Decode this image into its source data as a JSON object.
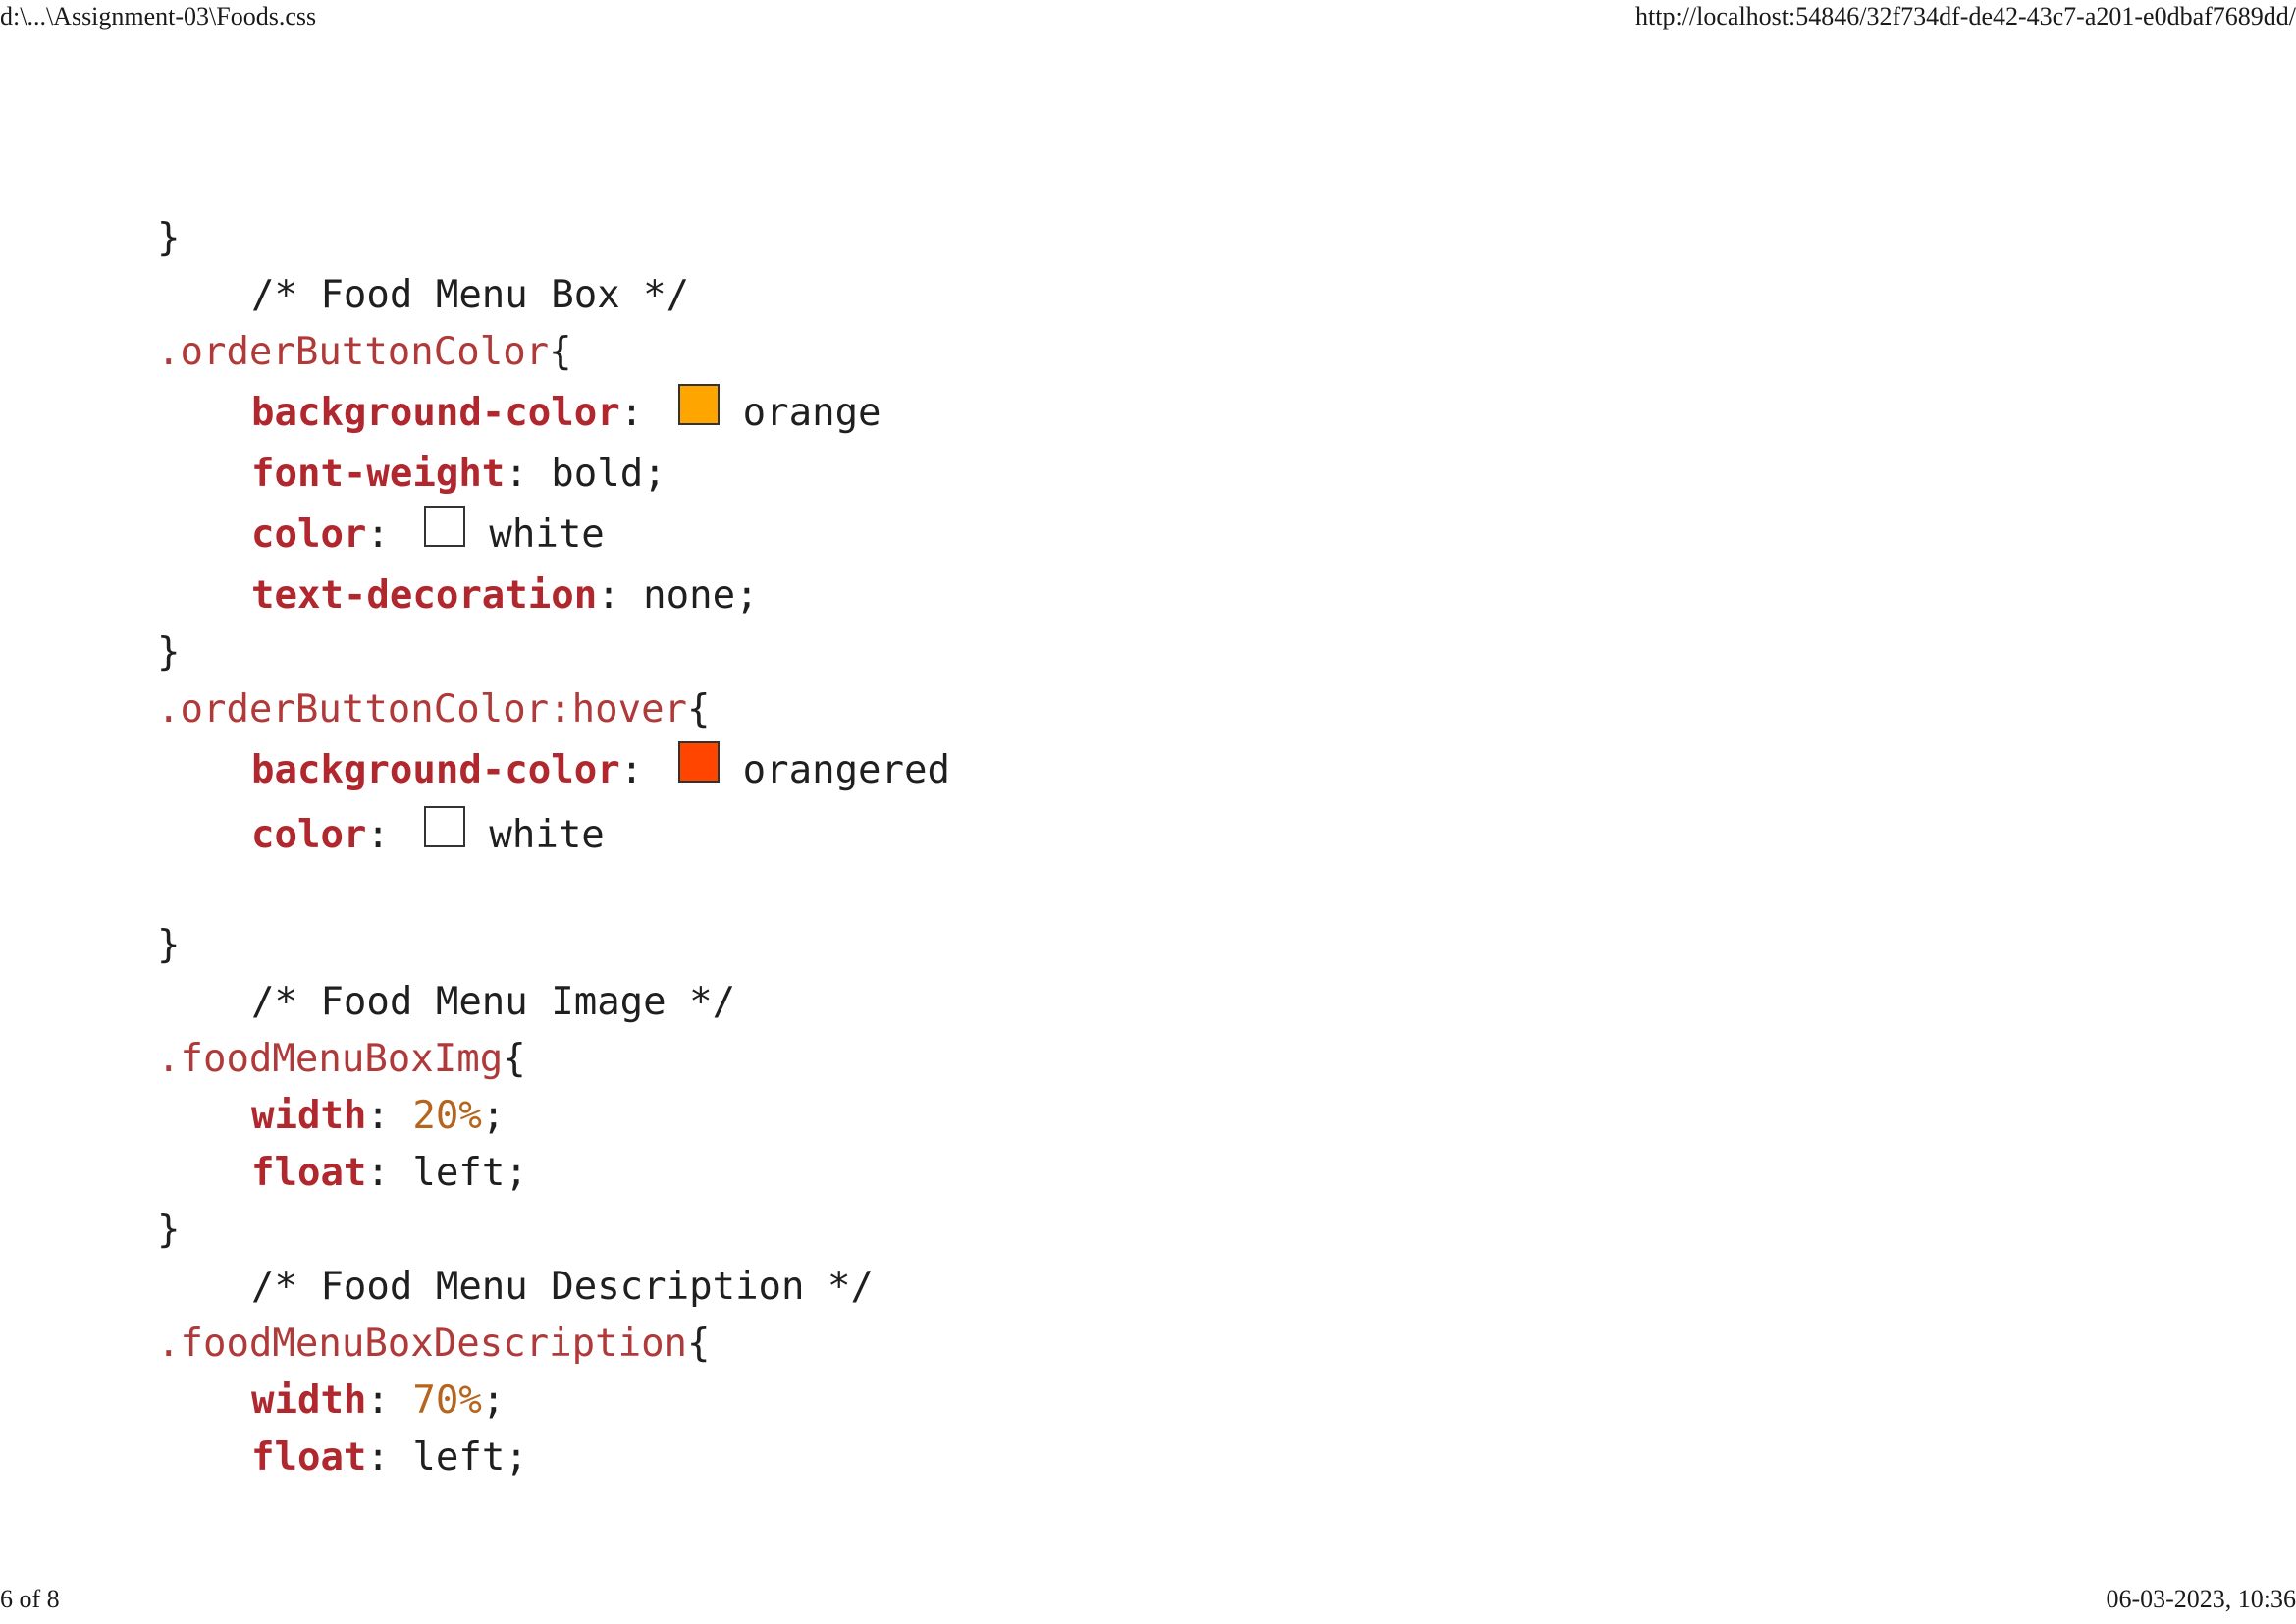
{
  "print_header": {
    "file_path": "d:\\...\\Assignment-03\\Foods.css",
    "url": "http://localhost:54846/32f734df-de42-43c7-a201-e0dbaf7689dd/"
  },
  "print_footer": {
    "page": "6 of 8",
    "datetime": "06-03-2023, 10:36"
  },
  "code": {
    "brace_close": "}",
    "brace_open": "{",
    "colon": ": ",
    "semicolon": ";",
    "comment_menu_box": "/* Food Menu Box */",
    "sel_order_button": ".orderButtonColor",
    "sel_order_button_hover": ".orderButtonColor:hover",
    "comment_menu_image": "/* Food Menu Image */",
    "sel_menu_img": ".foodMenuBoxImg",
    "comment_menu_desc": "/* Food Menu Description */",
    "sel_menu_desc": ".foodMenuBoxDescription",
    "prop_background_color": "background-color",
    "prop_font_weight": "font-weight",
    "prop_color": "color",
    "prop_text_decoration": "text-decoration",
    "prop_width": "width",
    "prop_float": "float",
    "val_orange": "orange",
    "val_bold": "bold;",
    "val_white": "white",
    "val_none": "none;",
    "val_orangered": "orangered",
    "val_20": "20%",
    "val_70": "70%",
    "val_left": "left;",
    "swatch_orange": "#ffa500",
    "swatch_white": "#ffffff",
    "swatch_orangered": "#ff4500"
  }
}
